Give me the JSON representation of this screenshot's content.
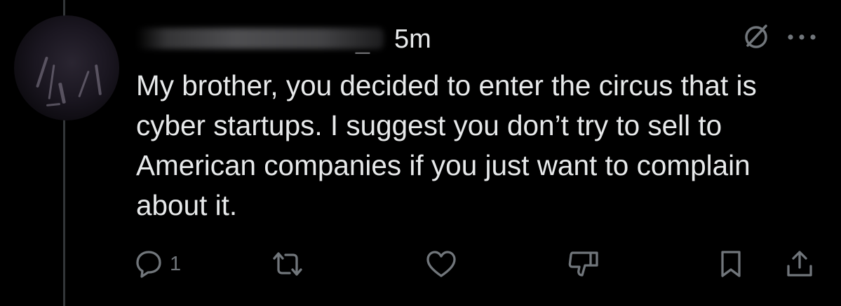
{
  "tweet": {
    "author_handle_visible": "_",
    "timestamp": "5m",
    "text": "My brother, you decided to enter the circus that is cyber startups. I suggest you don’t try to sell to American companies if you just want to complain about it."
  },
  "actions": {
    "reply_count": "1"
  },
  "icons": {
    "grok": "grok-icon",
    "more": "more-icon",
    "reply": "reply-icon",
    "retweet": "retweet-icon",
    "like": "heart-icon",
    "downvote": "thumbs-down-icon",
    "bookmark": "bookmark-icon",
    "share": "share-icon"
  },
  "colors": {
    "background": "#000000",
    "text": "#e7e9ea",
    "muted": "#71767b",
    "thread_line": "#333639"
  }
}
